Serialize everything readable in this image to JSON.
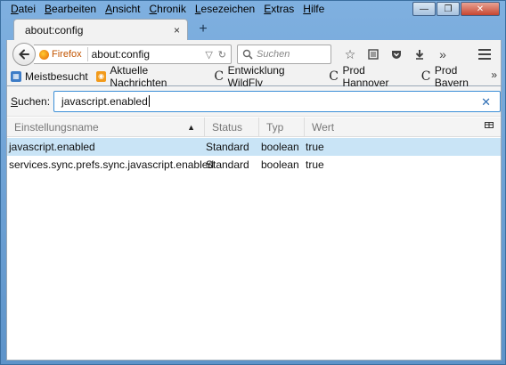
{
  "menubar": {
    "items": [
      "Datei",
      "Bearbeiten",
      "Ansicht",
      "Chronik",
      "Lesezeichen",
      "Extras",
      "Hilfe"
    ],
    "accel": [
      "D",
      "B",
      "A",
      "C",
      "L",
      "E",
      "H"
    ]
  },
  "window_controls": {
    "minimize": "—",
    "maximize": "❐",
    "close": "✕"
  },
  "tabs": [
    {
      "title": "about:config",
      "close": "×"
    }
  ],
  "new_tab": "+",
  "nav": {
    "identity_label": "Firefox",
    "url": "about:config",
    "search_placeholder": "Suchen",
    "overflow": "»"
  },
  "bookmarks": {
    "items": [
      {
        "label": "Meistbesucht",
        "icon": "folder-blue-icon"
      },
      {
        "label": "Aktuelle Nachrichten",
        "icon": "rss-icon"
      },
      {
        "label": "Entwicklung WildFly",
        "icon": "c-icon"
      },
      {
        "label": "Prod Hannover",
        "icon": "c-icon"
      },
      {
        "label": "Prod Bayern",
        "icon": "c-icon"
      }
    ],
    "overflow": "»"
  },
  "config": {
    "search_label_prefix": "S",
    "search_label_rest": "uchen:",
    "search_value": "javascript.enabled",
    "clear": "✕",
    "columns": [
      "Einstellungsname",
      "Status",
      "Typ",
      "Wert"
    ],
    "rows": [
      {
        "name": "javascript.enabled",
        "status": "Standard",
        "type": "boolean",
        "value": "true",
        "selected": true
      },
      {
        "name": "services.sync.prefs.sync.javascript.enabled",
        "status": "Standard",
        "type": "boolean",
        "value": "true",
        "selected": false
      }
    ]
  }
}
